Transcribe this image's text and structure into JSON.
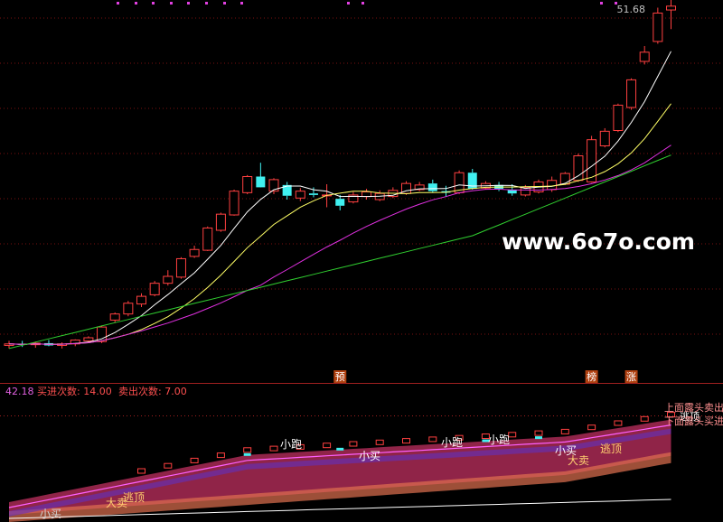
{
  "watermark": "www.6o7o.com",
  "chart_data": [
    {
      "type": "candlestick",
      "price_label": "51.68",
      "ylim": [
        3,
        53
      ],
      "candles": [
        {
          "o": 8.0,
          "h": 8.6,
          "l": 7.6,
          "c": 8.2
        },
        {
          "o": 8.2,
          "h": 8.6,
          "l": 7.8,
          "c": 8.1
        },
        {
          "o": 8.1,
          "h": 8.5,
          "l": 7.7,
          "c": 8.3
        },
        {
          "o": 8.3,
          "h": 8.7,
          "l": 7.9,
          "c": 8.0
        },
        {
          "o": 8.0,
          "h": 8.4,
          "l": 7.6,
          "c": 8.2
        },
        {
          "o": 8.2,
          "h": 8.8,
          "l": 7.9,
          "c": 8.7
        },
        {
          "o": 8.6,
          "h": 9.2,
          "l": 8.3,
          "c": 9.0
        },
        {
          "o": 8.5,
          "h": 10.6,
          "l": 8.3,
          "c": 10.4
        },
        {
          "o": 11.3,
          "h": 12.3,
          "l": 11.0,
          "c": 12.1
        },
        {
          "o": 12.1,
          "h": 13.8,
          "l": 11.8,
          "c": 13.5
        },
        {
          "o": 13.4,
          "h": 14.8,
          "l": 13.0,
          "c": 14.4
        },
        {
          "o": 14.6,
          "h": 16.4,
          "l": 14.4,
          "c": 16.1
        },
        {
          "o": 16.1,
          "h": 17.8,
          "l": 15.8,
          "c": 17.0
        },
        {
          "o": 16.9,
          "h": 19.5,
          "l": 16.7,
          "c": 19.3
        },
        {
          "o": 19.6,
          "h": 21.0,
          "l": 19.4,
          "c": 20.5
        },
        {
          "o": 20.4,
          "h": 23.5,
          "l": 20.3,
          "c": 23.3
        },
        {
          "o": 23.0,
          "h": 25.3,
          "l": 22.8,
          "c": 25.1
        },
        {
          "o": 25.0,
          "h": 28.3,
          "l": 24.9,
          "c": 28.1
        },
        {
          "o": 27.9,
          "h": 30.2,
          "l": 27.7,
          "c": 30.0
        },
        {
          "o": 30.0,
          "h": 31.8,
          "l": 29.5,
          "c": 28.6
        },
        {
          "o": 28.1,
          "h": 29.8,
          "l": 27.7,
          "c": 29.6
        },
        {
          "o": 28.9,
          "h": 29.3,
          "l": 27.0,
          "c": 27.5
        },
        {
          "o": 27.2,
          "h": 28.5,
          "l": 26.8,
          "c": 28.1
        },
        {
          "o": 27.8,
          "h": 28.6,
          "l": 27.3,
          "c": 27.6
        },
        {
          "o": 27.5,
          "h": 29.0,
          "l": 26.0,
          "c": 27.6
        },
        {
          "o": 27.1,
          "h": 27.6,
          "l": 25.6,
          "c": 26.2
        },
        {
          "o": 26.7,
          "h": 28.0,
          "l": 26.5,
          "c": 27.6
        },
        {
          "o": 27.4,
          "h": 28.4,
          "l": 27.0,
          "c": 28.0
        },
        {
          "o": 27.0,
          "h": 28.2,
          "l": 26.8,
          "c": 27.8
        },
        {
          "o": 27.4,
          "h": 28.6,
          "l": 27.2,
          "c": 28.2
        },
        {
          "o": 27.8,
          "h": 29.4,
          "l": 27.6,
          "c": 29.1
        },
        {
          "o": 28.3,
          "h": 29.3,
          "l": 28.1,
          "c": 28.9
        },
        {
          "o": 29.1,
          "h": 29.6,
          "l": 27.9,
          "c": 28.1
        },
        {
          "o": 28.1,
          "h": 28.8,
          "l": 27.4,
          "c": 27.9
        },
        {
          "o": 27.9,
          "h": 30.8,
          "l": 27.7,
          "c": 30.5
        },
        {
          "o": 30.5,
          "h": 31.0,
          "l": 28.3,
          "c": 28.4
        },
        {
          "o": 28.5,
          "h": 29.4,
          "l": 28.3,
          "c": 29.1
        },
        {
          "o": 28.9,
          "h": 29.3,
          "l": 28.1,
          "c": 28.4
        },
        {
          "o": 28.3,
          "h": 29.0,
          "l": 27.5,
          "c": 27.8
        },
        {
          "o": 27.6,
          "h": 28.9,
          "l": 27.4,
          "c": 28.6
        },
        {
          "o": 28.0,
          "h": 29.6,
          "l": 27.8,
          "c": 29.3
        },
        {
          "o": 28.3,
          "h": 30.0,
          "l": 28.0,
          "c": 29.5
        },
        {
          "o": 29.0,
          "h": 30.6,
          "l": 28.9,
          "c": 30.4
        },
        {
          "o": 29.5,
          "h": 33.0,
          "l": 29.3,
          "c": 32.7
        },
        {
          "o": 29.3,
          "h": 35.3,
          "l": 29.2,
          "c": 34.8
        },
        {
          "o": 34.0,
          "h": 36.3,
          "l": 33.8,
          "c": 35.9
        },
        {
          "o": 36.0,
          "h": 39.5,
          "l": 35.8,
          "c": 39.3
        },
        {
          "o": 39.0,
          "h": 42.8,
          "l": 38.7,
          "c": 42.6
        },
        {
          "o": 45.0,
          "h": 47.0,
          "l": 44.6,
          "c": 46.2
        },
        {
          "o": 47.6,
          "h": 52.0,
          "l": 47.3,
          "c": 51.3
        },
        {
          "o": 51.7,
          "h": 53.0,
          "l": 49.2,
          "c": 52.2
        }
      ],
      "ma_colors": [
        "#ffffff",
        "#ffff66",
        "#e030e0",
        "#30d030"
      ],
      "signals": [
        "预",
        "榜",
        "涨"
      ],
      "signal_indices": [
        25,
        44,
        47
      ]
    },
    {
      "type": "indicator",
      "header": {
        "value": "42.18",
        "buy_text": "买进次数: 14.00",
        "sell_text": "卖出次数: 7.00"
      },
      "labels": {
        "xiaomai": "小买",
        "damai1": "大卖",
        "taoding1": "逃顶",
        "xiaopao1": "小跑",
        "xiaomai2": "小买",
        "xiaopao2": "小跑",
        "xiaopao3": "小跑",
        "xiaomai3": "小买",
        "damai2": "大卖",
        "taoding2": "逃顶",
        "legend1": "上面露头卖出",
        "legend2": "下面露头买进",
        "legend3": "逃顶"
      }
    }
  ]
}
